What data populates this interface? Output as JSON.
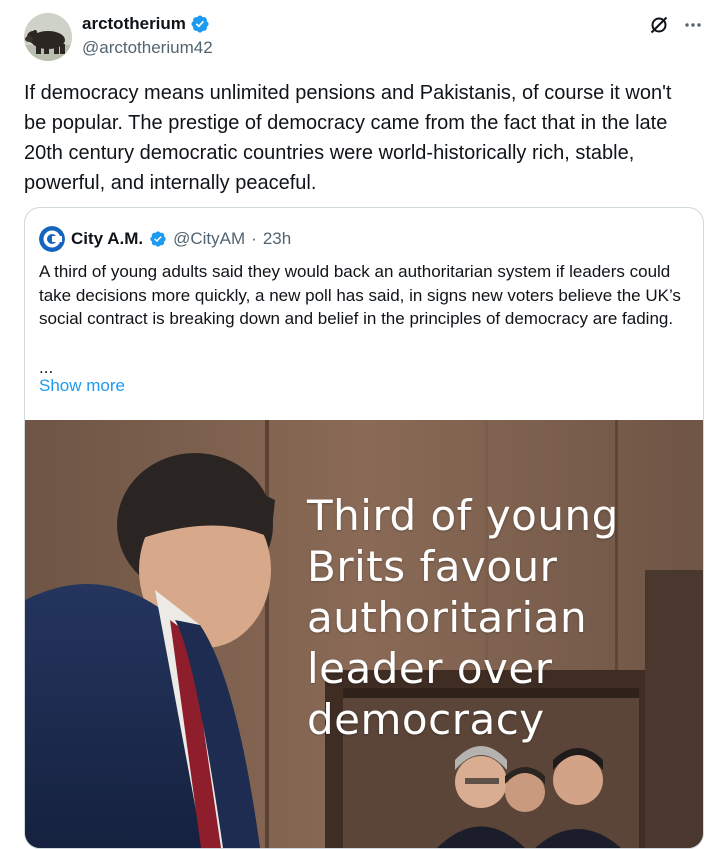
{
  "author": {
    "name": "arctotherium",
    "handle": "@arctotherium42"
  },
  "tweet": {
    "text": "If democracy means unlimited pensions and Pakistanis, of course it won't be popular. The prestige of democracy came from the fact that in the late 20th century democratic countries were world-historically rich, stable, powerful, and internally peaceful."
  },
  "icons": {
    "verified": "verified-badge-icon",
    "grok": "grok-icon",
    "more": "more-options-icon"
  },
  "quote": {
    "name": "City A.M.",
    "handle": "@CityAM",
    "separator": "·",
    "time": "23h",
    "text": "A third of young adults said they would back an authoritarian system if leaders could take decisions more quickly, a new poll has said, in signs new voters believe the UK’s social contract is breaking down and belief in the principles of democracy are fading.",
    "ellipsis": "...",
    "show_more": "Show more",
    "media_headline": "Third of young\nBrits favour\nauthoritarian\nleader over\ndemocracy"
  },
  "colors": {
    "accent": "#1d9bf0",
    "text": "#0f1419",
    "secondary": "#536471",
    "border": "#cfd9de"
  }
}
